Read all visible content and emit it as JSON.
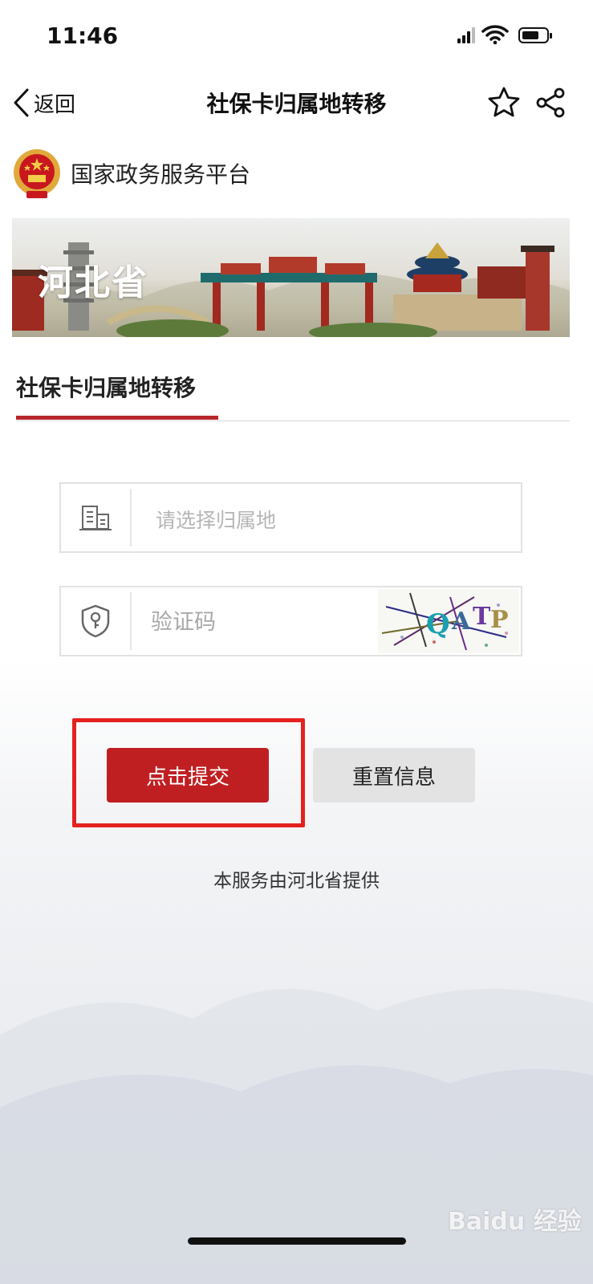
{
  "status_bar": {
    "time": "11:46"
  },
  "nav": {
    "back_label": "返回",
    "title": "社保卡归属地转移"
  },
  "platform": {
    "name": "国家政务服务平台"
  },
  "banner": {
    "title": "河北省"
  },
  "tab": {
    "label": "社保卡归属地转移"
  },
  "form": {
    "region_placeholder": "请选择归属地",
    "captcha_placeholder": "验证码",
    "captcha_text": "QATP"
  },
  "buttons": {
    "submit": "点击提交",
    "reset": "重置信息"
  },
  "footer": {
    "note": "本服务由河北省提供"
  },
  "watermark": {
    "text": "Baidu 经验"
  },
  "colors": {
    "accent": "#c01f22",
    "highlight": "#e4211f"
  }
}
